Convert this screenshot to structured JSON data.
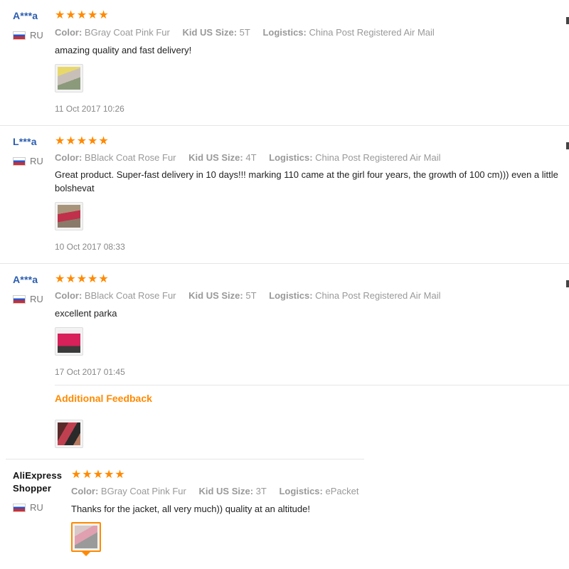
{
  "reviews": [
    {
      "user": "A***a",
      "country": "RU",
      "attrs": [
        {
          "k": "Color:",
          "v": "BGray Coat Pink Fur"
        },
        {
          "k": "Kid US Size:",
          "v": "5T"
        },
        {
          "k": "Logistics:",
          "v": "China Post Registered Air Mail"
        }
      ],
      "text": "amazing quality and fast delivery!",
      "date": "11 Oct 2017 10:26"
    },
    {
      "user": "L***a",
      "country": "RU",
      "attrs": [
        {
          "k": "Color:",
          "v": "BBlack Coat Rose Fur"
        },
        {
          "k": "Kid US Size:",
          "v": "4T"
        },
        {
          "k": "Logistics:",
          "v": "China Post Registered Air Mail"
        }
      ],
      "text": "Great product. Super-fast delivery in 10 days!!! marking 110 came at the girl four years, the growth of 100 cm))) even a little bolshevat",
      "date": "10 Oct 2017 08:33"
    },
    {
      "user": "A***a",
      "country": "RU",
      "attrs": [
        {
          "k": "Color:",
          "v": "BBlack Coat Rose Fur"
        },
        {
          "k": "Kid US Size:",
          "v": "5T"
        },
        {
          "k": "Logistics:",
          "v": "China Post Registered Air Mail"
        }
      ],
      "text": "excellent parka",
      "date": "17 Oct 2017 01:45",
      "additional_feedback_label": "Additional Feedback"
    },
    {
      "user": "AliExpress Shopper",
      "country": "RU",
      "attrs": [
        {
          "k": "Color:",
          "v": "BGray Coat Pink Fur"
        },
        {
          "k": "Kid US Size:",
          "v": "3T"
        },
        {
          "k": "Logistics:",
          "v": "ePacket"
        }
      ],
      "text": "Thanks for the jacket, all very much)) quality at an altitude!"
    }
  ],
  "rating": {
    "stars": 5,
    "max": 5
  },
  "colors": {
    "link": "#2a5db0",
    "star": "#ff8a00",
    "muted": "#999999"
  }
}
